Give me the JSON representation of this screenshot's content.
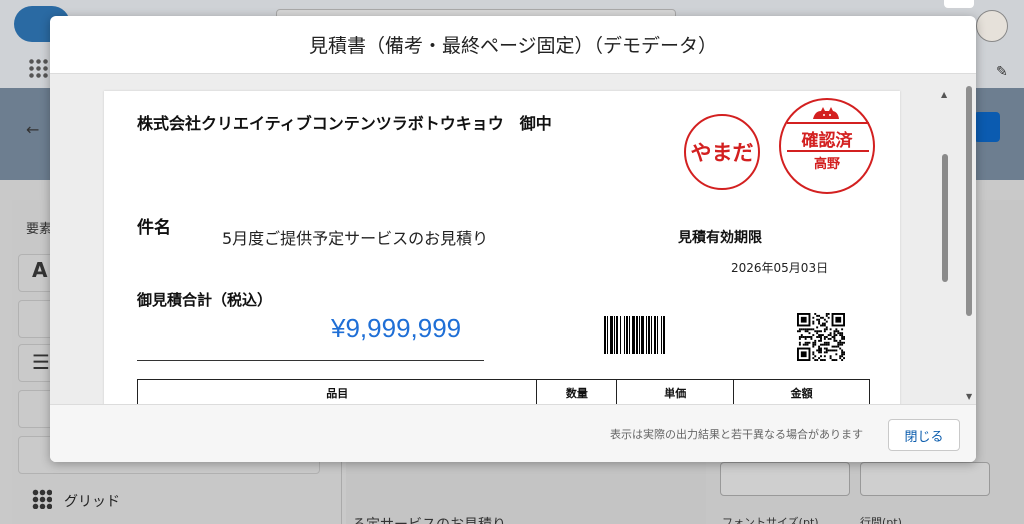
{
  "modal": {
    "title": "見積書（備考・最終ページ固定）（デモデータ）",
    "footer_note": "表示は実際の出力結果と若干異なる場合があります",
    "close_label": "閉じる"
  },
  "document": {
    "recipient": "株式会社クリエイティブコンテンツラボトウキョウ　御中",
    "subject_label": "件名",
    "subject_value": "5月度ご提供予定サービスのお見積り",
    "validity_label": "見積有効期限",
    "validity_date": "2026年05月03日",
    "total_label": "御見積合計（税込）",
    "total_value": "¥9,999,999",
    "stamp_name": "やまだ",
    "stamp_confirm_top": "確認済",
    "stamp_confirm_bottom": "高野",
    "table_headers": [
      "品目",
      "数量",
      "単価",
      "金額"
    ]
  },
  "background": {
    "sidebar_title": "要素",
    "grid_label": "グリッド",
    "center_text": "る定サービスのお見積り",
    "right_label_1": "フォントサイズ(pt)",
    "right_label_2": "行間(pt)"
  },
  "colors": {
    "accent": "#1f6fd6",
    "stamp": "#d32020",
    "button_text": "#0b5cad"
  }
}
